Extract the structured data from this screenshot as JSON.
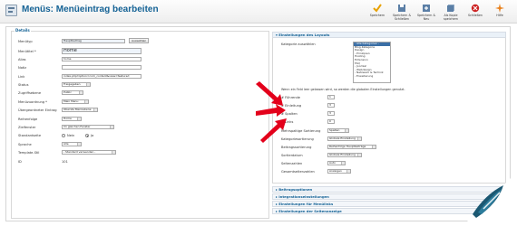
{
  "header": {
    "title": "Menüs: Menüeintrag bearbeiten",
    "toolbar": [
      {
        "label": "Speichern",
        "icon": "check-icon"
      },
      {
        "label": "Speichern & Schließen",
        "icon": "save-close-icon"
      },
      {
        "label": "Speichern & Neu",
        "icon": "save-new-icon"
      },
      {
        "label": "Als Kopie speichern",
        "icon": "save-copy-icon"
      },
      {
        "label": "Schließen",
        "icon": "close-icon"
      },
      {
        "label": "Hilfe",
        "icon": "help-icon"
      }
    ]
  },
  "details": {
    "legend": "Details",
    "fields": [
      {
        "label": "Menütyp",
        "value": "Hauptbeitrag",
        "button": "Auswählen"
      },
      {
        "label": "Menütitel *",
        "value": "Home"
      },
      {
        "label": "Alias",
        "value": "home"
      },
      {
        "label": "Notiz",
        "value": ""
      },
      {
        "label": "Link",
        "value": "index.php?option=com_content&view=featured"
      },
      {
        "label": "Status",
        "value": "Freigegeben"
      },
      {
        "label": "Zugriffsebene",
        "value": "Public"
      },
      {
        "label": "Menüzuordnung *",
        "value": "Main Menu"
      },
      {
        "label": "Übergeordneter Eintrag",
        "value": "Oberste Menüebene"
      },
      {
        "label": "Reihenfolge",
        "value": "Home"
      },
      {
        "label": "Zielfenster",
        "value": "Im gleichen Fenster"
      },
      {
        "label": "Standardseite",
        "radio_no": "Nein",
        "radio_yes": "Ja"
      },
      {
        "label": "Sprache",
        "value": "Alle"
      },
      {
        "label": "Template-Stil",
        "value": "- Standard verwenden -"
      },
      {
        "label": "ID",
        "value": "101"
      }
    ]
  },
  "layout": {
    "title": "Einstellungen des Layouts",
    "category_label": "Kategorie auswählen",
    "categories": [
      "- Alle Kategorien -",
      "Blog-Kategorie",
      "Design",
      "- Prinzipien",
      "Hosting",
      "Extension",
      "FAQ",
      "- Joomla!",
      "- Webdesign",
      "- Netzwerk & Technik",
      "- Erweiterung"
    ],
    "hint": "Wenn ein Feld leer gelassen wird, so werden die globalen Einstellungen genutzt.",
    "numeric_fields": [
      {
        "label": "# Führende",
        "value": "1"
      },
      {
        "label": "# Einleitung",
        "value": "3"
      },
      {
        "label": "# Spalten",
        "value": "3"
      },
      {
        "label": "# Links",
        "value": "0"
      }
    ],
    "select_fields": [
      {
        "label": "Mehrspaltige Sortierung",
        "value": "Spalten"
      },
      {
        "label": "Kategoriesortierung",
        "value": "Globale Einstellung"
      },
      {
        "label": "Beitragssortierung",
        "value": "Reihenfolge Hauptbeiträge"
      },
      {
        "label": "Sortierdatum",
        "value": "Globale Einstellung"
      },
      {
        "label": "Seitenzahlen",
        "value": "Auto"
      },
      {
        "label": "Gesamtseitenzahlen",
        "value": "Anzeigen"
      }
    ]
  },
  "accordions": [
    "Beitragsoptionen",
    "Integrationseinstellungen",
    "Einstellungen für Menülinks",
    "Einstellungen der Seitenanzeige"
  ],
  "colors": {
    "accent": "#146295",
    "arrow": "#e3001b"
  }
}
